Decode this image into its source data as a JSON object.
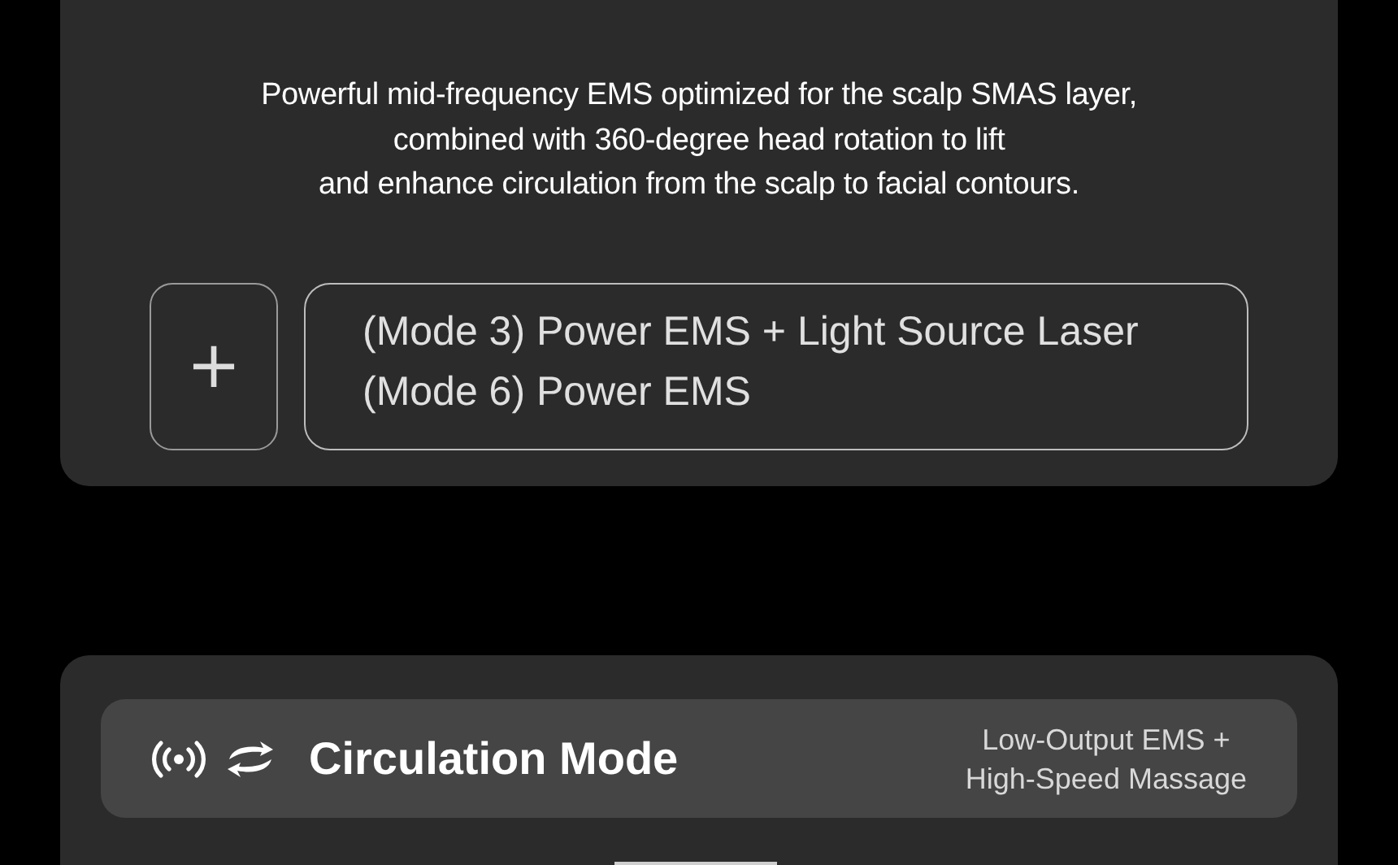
{
  "feature_card": {
    "description_lines": [
      "Powerful mid-frequency EMS optimized for the scalp SMAS layer,",
      "combined with 360-degree head rotation to lift",
      "and enhance circulation from the scalp to facial contours."
    ],
    "add_button": "+",
    "modes": [
      "(Mode 3) Power EMS + Light Source Laser",
      "(Mode 6) Power EMS"
    ]
  },
  "mode_card": {
    "title": "Circulation Mode",
    "subtitle_lines": [
      "Low-Output EMS +",
      "High-Speed Massage"
    ]
  }
}
